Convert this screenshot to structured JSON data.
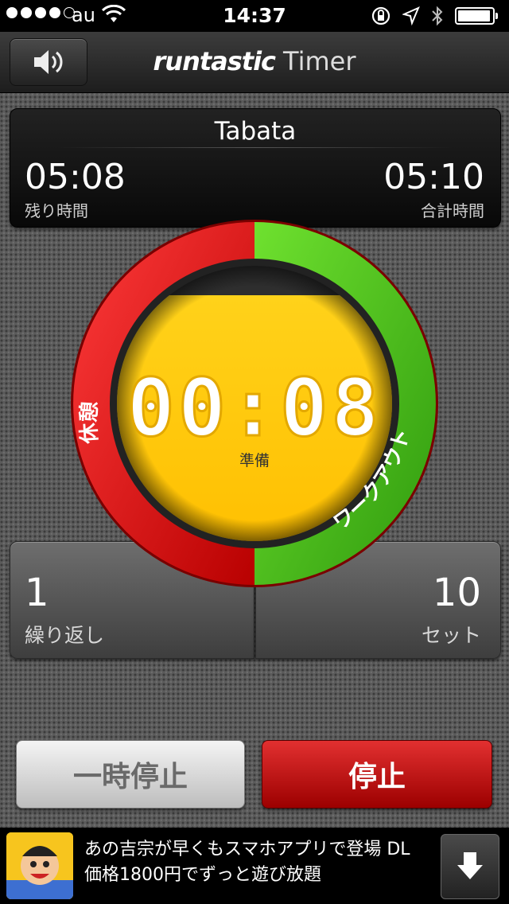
{
  "status_bar": {
    "signal_dots": 5,
    "signal_filled": 4,
    "carrier": "au",
    "time": "14:37",
    "icons": [
      "wifi-icon",
      "orientation-lock-icon",
      "location-icon",
      "bluetooth-icon",
      "battery-icon"
    ]
  },
  "nav": {
    "brand": "runtastic",
    "title": "Timer",
    "sound_icon": "speaker-icon"
  },
  "info": {
    "workout_name": "Tabata",
    "remaining_time": "05:08",
    "remaining_label": "残り時間",
    "total_time": "05:10",
    "total_label": "合計時間"
  },
  "dial": {
    "countdown": "00:08",
    "phase_label": "準備",
    "rest_label": "休憩",
    "workout_label": "ワークアウト",
    "colors": {
      "rest": "#e00000",
      "workout": "#45b51b",
      "face": "#ffc800"
    }
  },
  "stats": {
    "rounds_value": "1",
    "rounds_label": "繰り返し",
    "sets_value": "10",
    "sets_label": "セット"
  },
  "buttons": {
    "pause_label": "一時停止",
    "stop_label": "停止"
  },
  "ad": {
    "text": "あの吉宗が早くもスマホアプリで登場 DL価格1800円でずっと遊び放題",
    "thumb_icon": "ad-character-icon",
    "download_icon": "download-arrow-icon"
  }
}
